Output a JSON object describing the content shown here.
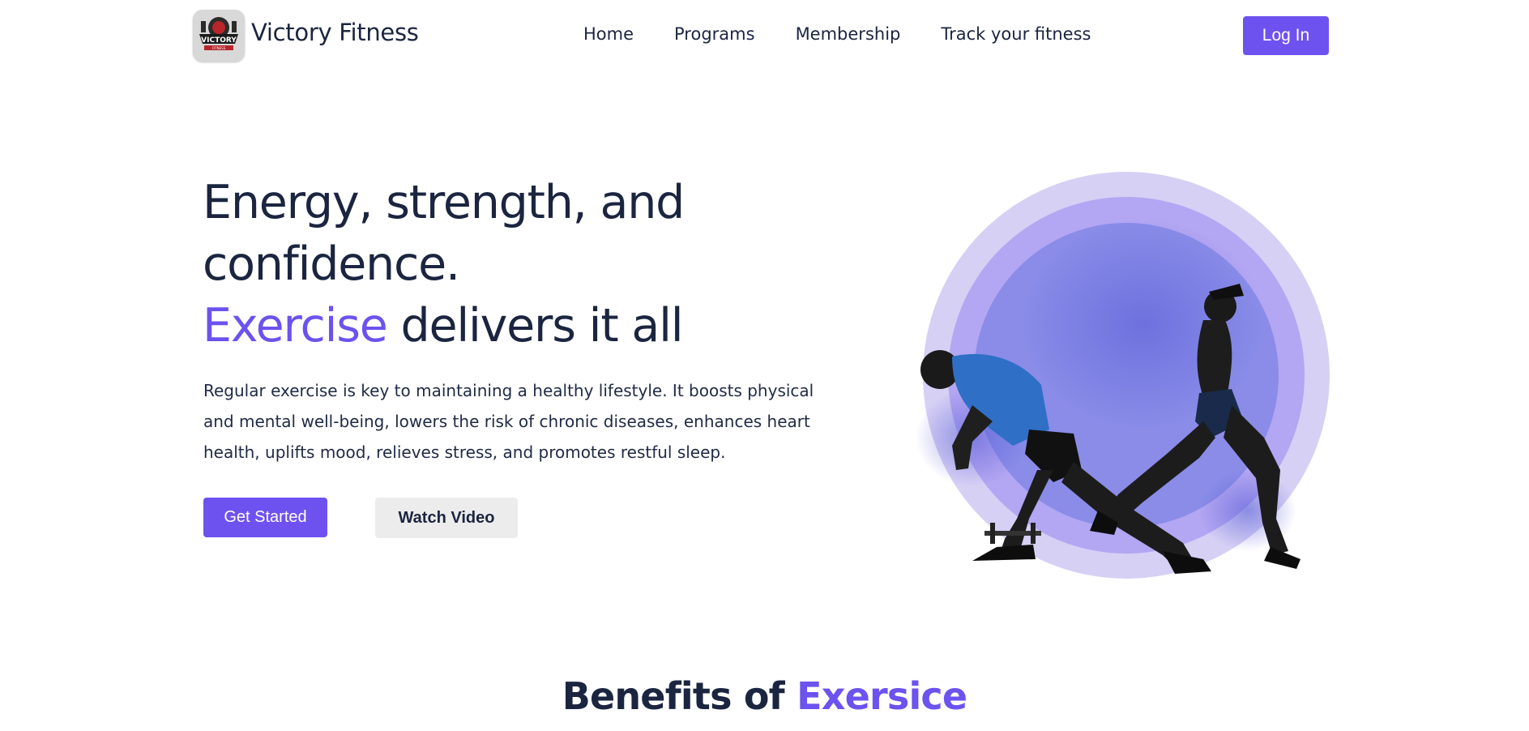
{
  "header": {
    "brand": "Victory Fitness",
    "logo_text": "VICTORY",
    "logo_subtext": "FITNESS",
    "nav": [
      {
        "label": "Home"
      },
      {
        "label": "Programs"
      },
      {
        "label": "Membership"
      },
      {
        "label": "Track your fitness"
      }
    ],
    "login_label": "Log In"
  },
  "hero": {
    "title_line1": "Energy, strength, and",
    "title_line2": "confidence.",
    "title_accent": "Exercise",
    "title_rest": " delivers it all",
    "description": "Regular exercise is key to maintaining a healthy lifestyle. It boosts physical and mental well-being, lowers the risk of chronic diseases, enhances heart health, uplifts mood, relieves stress, and promotes restful sleep.",
    "primary_button": "Get Started",
    "secondary_button": "Watch Video"
  },
  "benefits": {
    "title_prefix": "Benefits of ",
    "title_accent": "Exersice"
  },
  "colors": {
    "accent": "#6e52f0",
    "text": "#1b2540",
    "circle_outer": "#d6d0f5",
    "circle_mid": "#b3a6f2",
    "circle_inner": "#8a8ce8"
  }
}
